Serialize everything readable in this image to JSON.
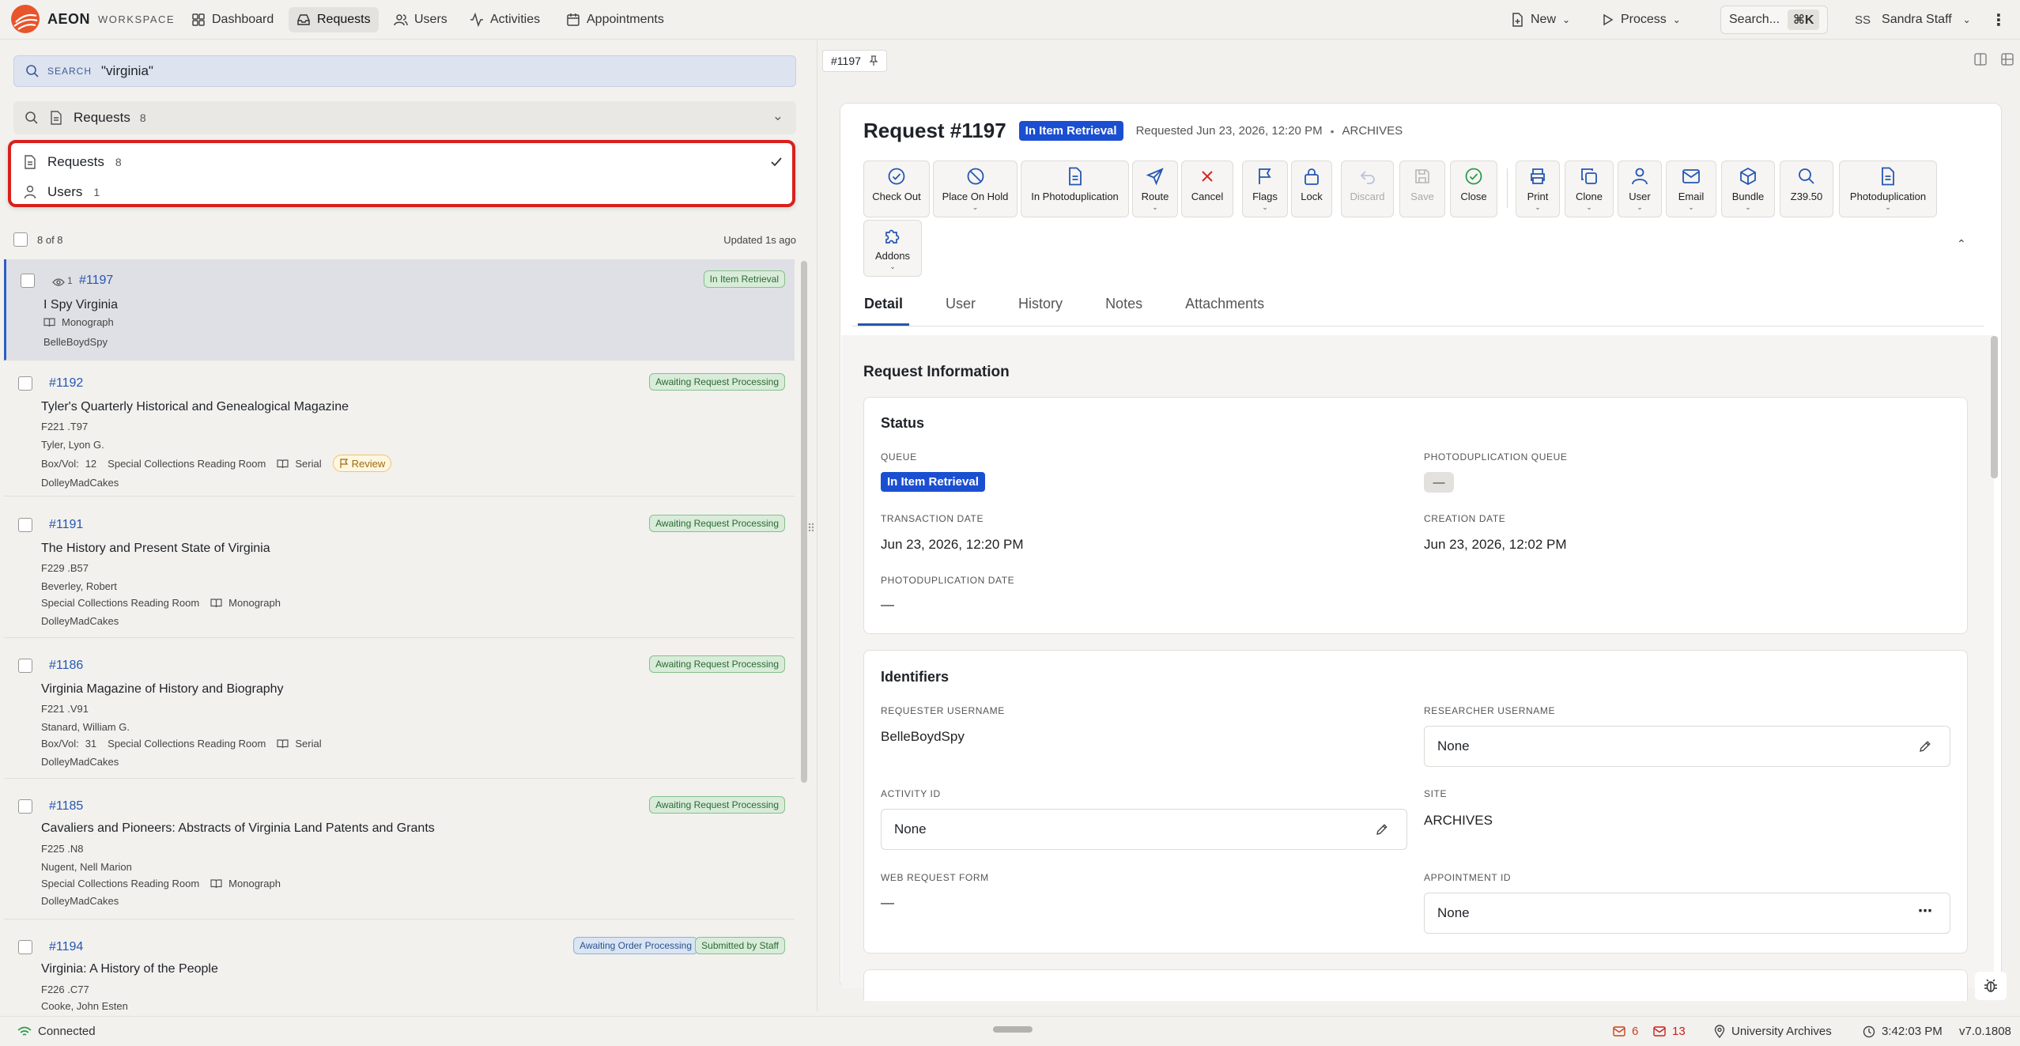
{
  "app": {
    "brand": "AEON",
    "brand_sub": "WORKSPACE"
  },
  "nav": {
    "items": [
      {
        "label": "Dashboard",
        "icon": "dashboard-icon"
      },
      {
        "label": "Requests",
        "icon": "inbox-icon"
      },
      {
        "label": "Users",
        "icon": "users-icon"
      },
      {
        "label": "Activities",
        "icon": "activity-icon"
      },
      {
        "label": "Appointments",
        "icon": "calendar-icon"
      }
    ],
    "new_label": "New",
    "process_label": "Process",
    "search_label": "Search...",
    "search_shortcut": "⌘K",
    "user_initials": "SS",
    "user_name": "Sandra Staff"
  },
  "search": {
    "label": "SEARCH",
    "query": "\"virginia\""
  },
  "scope": {
    "label": "Requests",
    "count": "8"
  },
  "scope_dropdown": [
    {
      "label": "Requests",
      "count": "8",
      "selected": true
    },
    {
      "label": "Users",
      "count": "1",
      "selected": false
    }
  ],
  "list": {
    "count_text": "8 of 8",
    "updated_text": "Updated 1s ago",
    "items": [
      {
        "id": "#1197",
        "views": "1",
        "title": "I Spy Virginia",
        "type": "Monograph",
        "user": "BelleBoydSpy",
        "badges": [
          "In Item Retrieval"
        ]
      },
      {
        "id": "#1192",
        "title": "Tyler's Quarterly Historical and Genealogical Magazine",
        "call": "F221 .T97",
        "author": "Tyler, Lyon G.",
        "boxvol": "Box/Vol:",
        "boxnum": "12",
        "site": "Special Collections Reading Room",
        "type": "Serial",
        "flag": "Review",
        "user": "DolleyMadCakes",
        "badges": [
          "Awaiting Request Processing"
        ]
      },
      {
        "id": "#1191",
        "title": "The History and Present State of Virginia",
        "call": "F229 .B57",
        "author": "Beverley, Robert",
        "site": "Special Collections Reading Room",
        "type": "Monograph",
        "user": "DolleyMadCakes",
        "badges": [
          "Awaiting Request Processing"
        ]
      },
      {
        "id": "#1186",
        "title": "Virginia Magazine of History and Biography",
        "call": "F221 .V91",
        "author": "Stanard, William G.",
        "boxvol": "Box/Vol:",
        "boxnum": "31",
        "site": "Special Collections Reading Room",
        "type": "Serial",
        "user": "DolleyMadCakes",
        "badges": [
          "Awaiting Request Processing"
        ]
      },
      {
        "id": "#1185",
        "title": "Cavaliers and Pioneers: Abstracts of Virginia Land Patents and Grants",
        "call": "F225 .N8",
        "author": "Nugent, Nell Marion",
        "site": "Special Collections Reading Room",
        "type": "Monograph",
        "user": "DolleyMadCakes",
        "badges": [
          "Awaiting Request Processing"
        ]
      },
      {
        "id": "#1194",
        "title": "Virginia: A History of the People",
        "call": "F226 .C77",
        "author": "Cooke, John Esten",
        "badges": [
          "Awaiting Order Processing",
          "Submitted by Staff"
        ]
      }
    ]
  },
  "detail": {
    "tab_chip": "#1197",
    "title": "Request #1197",
    "queue_badge": "In Item Retrieval",
    "requested": "Requested Jun 23, 2026, 12:20 PM",
    "dot": "•",
    "site_tag": "ARCHIVES",
    "toolbar": [
      {
        "label": "Check Out",
        "icon": "check-circle-icon"
      },
      {
        "label": "Place On Hold",
        "icon": "ban-icon"
      },
      {
        "label": "In Photoduplication",
        "icon": "document-icon"
      },
      {
        "label": "Route",
        "icon": "send-icon",
        "caret": true
      },
      {
        "label": "Cancel",
        "icon": "x-icon"
      },
      {
        "label": "Flags",
        "icon": "flag-icon",
        "caret": true
      },
      {
        "label": "Lock",
        "icon": "lock-icon"
      },
      {
        "label": "Discard",
        "icon": "undo-icon",
        "disabled": true
      },
      {
        "label": "Save",
        "icon": "save-icon",
        "disabled": true
      },
      {
        "label": "Close",
        "icon": "check-circle-green-icon"
      },
      {
        "label": "Print",
        "icon": "printer-icon",
        "caret": true
      },
      {
        "label": "Clone",
        "icon": "copy-icon",
        "caret": true
      },
      {
        "label": "User",
        "icon": "user-icon",
        "caret": true
      },
      {
        "label": "Email",
        "icon": "mail-icon",
        "caret": true
      },
      {
        "label": "Bundle",
        "icon": "package-icon",
        "caret": true
      },
      {
        "label": "Z39.50",
        "icon": "search-icon"
      },
      {
        "label": "Photoduplication",
        "icon": "document-icon",
        "caret": true
      },
      {
        "label": "Addons",
        "icon": "puzzle-icon",
        "caret": true
      }
    ],
    "tabs": [
      "Detail",
      "User",
      "History",
      "Notes",
      "Attachments"
    ],
    "section_title": "Request Information",
    "status": {
      "heading": "Status",
      "queue_label": "QUEUE",
      "queue_value": "In Item Retrieval",
      "photo_queue_label": "PHOTODUPLICATION QUEUE",
      "photo_queue_value": "—",
      "transaction_label": "TRANSACTION DATE",
      "transaction_value": "Jun 23, 2026, 12:20 PM",
      "creation_label": "CREATION DATE",
      "creation_value": "Jun 23, 2026, 12:02 PM",
      "photo_date_label": "PHOTODUPLICATION DATE",
      "photo_date_value": "—"
    },
    "identifiers": {
      "heading": "Identifiers",
      "requester_label": "REQUESTER USERNAME",
      "requester_value": "BelleBoydSpy",
      "researcher_label": "RESEARCHER USERNAME",
      "researcher_value": "None",
      "activity_label": "ACTIVITY ID",
      "activity_value": "None",
      "site_label": "SITE",
      "site_value": "ARCHIVES",
      "webform_label": "WEB REQUEST FORM",
      "webform_value": "—",
      "appointment_label": "APPOINTMENT ID",
      "appointment_value": "None"
    }
  },
  "statusbar": {
    "connection": "Connected",
    "mail_count_a": "6",
    "mail_count_b": "13",
    "location": "University Archives",
    "time": "3:42:03 PM",
    "version": "v7.0.1808"
  },
  "colors": {
    "accent": "#2556b3",
    "queue_badge": "#1b4fd1",
    "highlight_border": "#d9201c",
    "logo": "#e8542b"
  }
}
